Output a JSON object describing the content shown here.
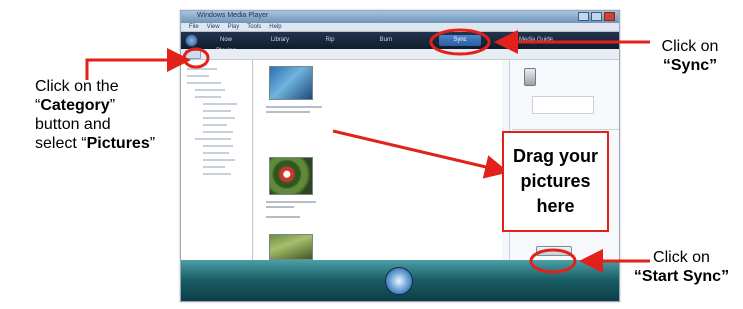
{
  "window": {
    "title": "Windows Media Player",
    "menu": [
      "File",
      "View",
      "Play",
      "Tools",
      "Help"
    ],
    "tabs": [
      "Now Playing",
      "Library",
      "Rip",
      "Burn",
      "Sync",
      "Media Guide"
    ]
  },
  "annotations": {
    "category": {
      "prefix": "Click on the",
      "open_quote": "“",
      "strong": "Category",
      "close_quote": "”",
      "line3": "button and",
      "line4_prefix": "select “",
      "line4_strong": "Pictures",
      "line4_suffix": "”"
    },
    "sync": {
      "line1": "Click on",
      "line2": "“Sync”"
    },
    "drag": {
      "line1": "Drag your",
      "line2": "pictures",
      "line3": "here"
    },
    "start_sync": {
      "line1": "Click on",
      "line2": "“Start Sync”"
    }
  },
  "colors": {
    "annotation_red": "#e3211b",
    "accent_blue": "#2b5ea6",
    "player_teal": "#1b5e66"
  }
}
